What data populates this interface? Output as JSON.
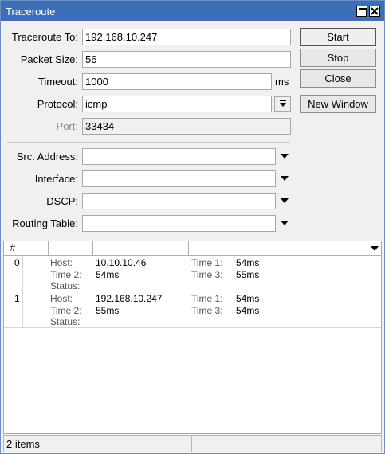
{
  "window": {
    "title": "Traceroute"
  },
  "form": {
    "traceroute_to": {
      "label": "Traceroute To:",
      "value": "192.168.10.247"
    },
    "packet_size": {
      "label": "Packet Size:",
      "value": "56"
    },
    "timeout": {
      "label": "Timeout:",
      "value": "1000",
      "unit": "ms"
    },
    "protocol": {
      "label": "Protocol:",
      "value": "icmp"
    },
    "port": {
      "label": "Port:",
      "value": "33434"
    },
    "src_address": {
      "label": "Src. Address:",
      "value": ""
    },
    "interface": {
      "label": "Interface:",
      "value": ""
    },
    "dscp": {
      "label": "DSCP:",
      "value": ""
    },
    "routing_table": {
      "label": "Routing Table:",
      "value": ""
    }
  },
  "buttons": {
    "start": "Start",
    "stop": "Stop",
    "close": "Close",
    "new_window": "New Window"
  },
  "list": {
    "header": {
      "index": "#"
    },
    "rows": [
      {
        "index": "0",
        "host_label": "Host:",
        "host": "10.10.10.46",
        "time1_label": "Time 1:",
        "time1": "54ms",
        "time2_label": "Time 2:",
        "time2": "54ms",
        "time3_label": "Time 3:",
        "time3": "55ms",
        "status_label": "Status:",
        "status": ""
      },
      {
        "index": "1",
        "host_label": "Host:",
        "host": "192.168.10.247",
        "time1_label": "Time 1:",
        "time1": "54ms",
        "time2_label": "Time 2:",
        "time2": "55ms",
        "time3_label": "Time 3:",
        "time3": "54ms",
        "status_label": "Status:",
        "status": ""
      }
    ]
  },
  "status_bar": {
    "items": "2 items"
  },
  "icons": [
    "maximize-icon",
    "close-icon",
    "dropdown-arrow-icon",
    "column-menu-icon"
  ],
  "colors": {
    "titlebar": "#3d6fb6",
    "window_bg": "#f0f0f0"
  }
}
